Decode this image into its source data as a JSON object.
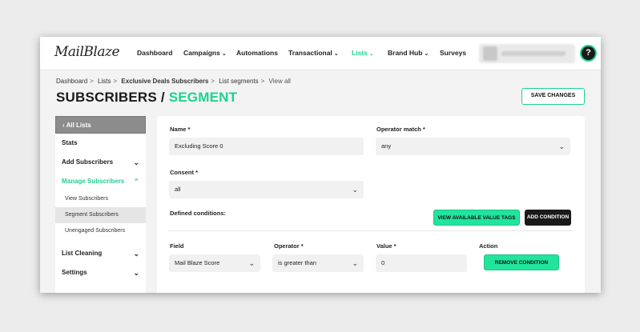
{
  "app": {
    "logo_text": "MailBlaze"
  },
  "nav": {
    "items": [
      {
        "label": "Dashboard",
        "has_dropdown": false,
        "active": false
      },
      {
        "label": "Campaigns",
        "has_dropdown": true,
        "active": false
      },
      {
        "label": "Automations",
        "has_dropdown": false,
        "active": false
      },
      {
        "label": "Transactional",
        "has_dropdown": true,
        "active": false
      },
      {
        "label": "Lists",
        "has_dropdown": true,
        "active": true
      },
      {
        "label": "Brand Hub",
        "has_dropdown": true,
        "active": false
      },
      {
        "label": "Surveys",
        "has_dropdown": false,
        "active": false
      }
    ],
    "dropdown_glyph": "⌄",
    "help_glyph": "?"
  },
  "breadcrumb": {
    "items": [
      "Dashboard",
      "Lists",
      "Exclusive Deals Subscribers",
      "List segments",
      "View all"
    ],
    "separator": ">"
  },
  "page": {
    "title_main": "SUBSCRIBERS /",
    "title_accent": "SEGMENT",
    "save_label": "SAVE CHANGES"
  },
  "sidebar": {
    "back_label": "‹  All Lists",
    "items": [
      {
        "label": "Stats"
      },
      {
        "label": "Add Subscribers",
        "caret": "⌄"
      },
      {
        "label": "Manage Subscribers",
        "caret": "⌃"
      }
    ],
    "sub_items": [
      {
        "label": "View Subscribers"
      },
      {
        "label": "Segment Subscribers",
        "selected": true
      },
      {
        "label": "Unengaged Subscribers"
      }
    ],
    "bottom_items": [
      {
        "label": "List Cleaning",
        "caret": "⌄"
      },
      {
        "label": "Settings",
        "caret": "⌄"
      }
    ]
  },
  "form": {
    "name_label": "Name *",
    "name_value": "Excluding Score 0",
    "operator_match_label": "Operator match *",
    "operator_match_value": "any",
    "consent_label": "Consent *",
    "consent_value": "all",
    "defined_conditions_label": "Defined conditions:",
    "view_tags_label": "VIEW AVAILABLE VALUE TAGS",
    "add_condition_label": "ADD CONDITION",
    "field_label": "Field",
    "field_value": "Mail Blaze Score",
    "operator_label": "Operator *",
    "operator_value": "is greater than",
    "value_label": "Value *",
    "value_value": "0",
    "action_label": "Action",
    "remove_condition_label": "REMOVE CONDITION",
    "dropdown_glyph": "⌄"
  },
  "colors": {
    "accent": "#1fd18f",
    "dark": "#1a1a1a"
  }
}
